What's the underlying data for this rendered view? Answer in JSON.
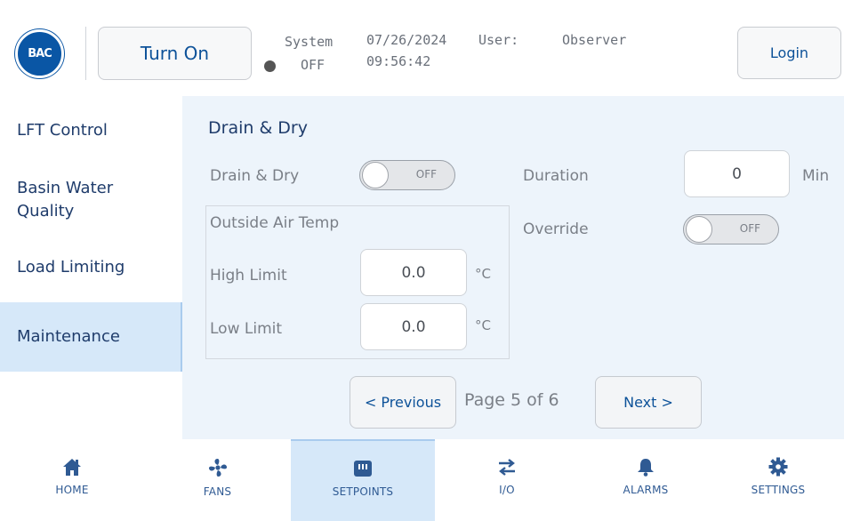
{
  "header": {
    "logo_text": "BAC",
    "turn_on_label": "Turn On",
    "system_label": "System",
    "system_status": "OFF",
    "date": "07/26/2024",
    "time": "09:56:42",
    "user_label": "User:",
    "user_value": "Observer",
    "login_label": "Login"
  },
  "sidebar": {
    "items": [
      {
        "label": "LFT Control"
      },
      {
        "label": "Basin Water Quality"
      },
      {
        "label": "Load Limiting"
      },
      {
        "label": "Maintenance"
      }
    ],
    "active_index": 3
  },
  "main": {
    "section_title": "Drain & Dry",
    "drain_dry_label": "Drain & Dry",
    "drain_dry_state": "OFF",
    "duration_label": "Duration",
    "duration_value": "0",
    "duration_unit": "Min",
    "override_label": "Override",
    "override_state": "OFF",
    "outside_air_title": "Outside Air Temp",
    "high_limit_label": "High Limit",
    "high_limit_value": "0.0",
    "low_limit_label": "Low Limit",
    "low_limit_value": "0.0",
    "temp_unit": "°C"
  },
  "pager": {
    "previous_label": "< Previous",
    "page_label": "Page 5 of 6",
    "next_label": "Next >"
  },
  "nav": {
    "items": [
      {
        "label": "HOME",
        "icon": "home-icon"
      },
      {
        "label": "FANS",
        "icon": "fan-icon"
      },
      {
        "label": "SETPOINTS",
        "icon": "setpoints-icon"
      },
      {
        "label": "I/O",
        "icon": "io-arrows-icon"
      },
      {
        "label": "ALARMS",
        "icon": "bell-icon"
      },
      {
        "label": "SETTINGS",
        "icon": "gear-icon"
      }
    ],
    "active_index": 2
  },
  "colors": {
    "accent": "#0d5299",
    "panel_bg": "#edf4fb",
    "active_bg": "#d6e8f9",
    "status_dot": "#555555"
  }
}
